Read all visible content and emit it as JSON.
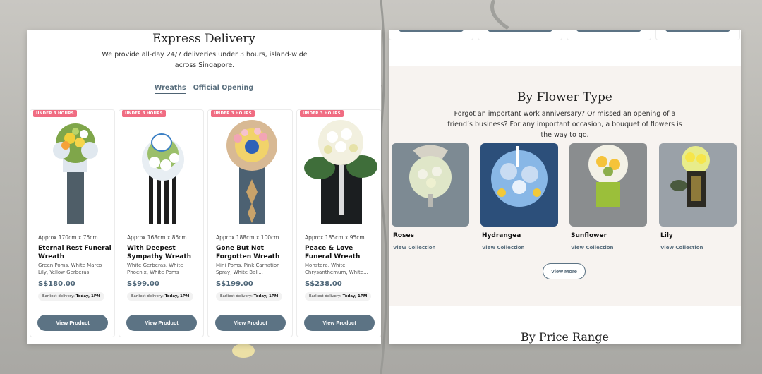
{
  "express": {
    "title": "Express Delivery",
    "description": "We provide all-day 24/7 deliveries under 3 hours, island-wide across Singapore.",
    "tabs": [
      "Wreaths",
      "Official Opening"
    ]
  },
  "products": [
    {
      "badge": "UNDER 3 HOURS",
      "size": "Approx 170cm x 75cm",
      "name": "Eternal Rest Funeral Wreath",
      "desc": "Green Poms, White Marco Lily, Yellow Gerberas",
      "price": "S$180.00",
      "delivery_prefix": "Earliest delivery:",
      "delivery_time": "Today, 1PM",
      "button": "View Product"
    },
    {
      "badge": "UNDER 3 HOURS",
      "size": "Approx 168cm x 85cm",
      "name": "With Deepest Sympathy Wreath",
      "desc": "White Gerberas, White Phoenix, White Poms",
      "price": "S$99.00",
      "delivery_prefix": "Earliest delivery:",
      "delivery_time": "Today, 1PM",
      "button": "View Product"
    },
    {
      "badge": "UNDER 3 HOURS",
      "size": "Approx 188cm x 100cm",
      "name": "Gone But Not Forgotten Wreath",
      "desc": "Mini Poms, Pink Carnation Spray, White Ball...",
      "price": "S$199.00",
      "delivery_prefix": "Earliest delivery:",
      "delivery_time": "Today, 1PM",
      "button": "View Product"
    },
    {
      "badge": "UNDER 3 HOURS",
      "size": "Approx 185cm x 95cm",
      "name": "Peace & Love Funeral Wreath",
      "desc": "Monstera, White Chrysanthemum, White...",
      "price": "S$238.00",
      "delivery_prefix": "Earliest delivery:",
      "delivery_time": "Today, 1PM",
      "button": "View Product"
    }
  ],
  "by_flower": {
    "title": "By Flower Type",
    "description": "Forgot an important work anniversary? Or missed an opening of a friend’s business? For any important occasion, a bouquet of flowers is the way to go.",
    "types": [
      {
        "name": "Roses",
        "link": "View Collection"
      },
      {
        "name": "Hydrangea",
        "link": "View Collection"
      },
      {
        "name": "Sunflower",
        "link": "View Collection"
      },
      {
        "name": "Lily",
        "link": "View Collection"
      }
    ],
    "more_button": "View More"
  },
  "by_price": {
    "title": "By Price Range"
  },
  "colors": {
    "badge": "#f06c82",
    "button": "#5c7384",
    "price": "#4e6678",
    "section_bg": "#f7f3f0"
  },
  "icons": [
    "flower-wreath-image",
    "flower-type-image"
  ]
}
